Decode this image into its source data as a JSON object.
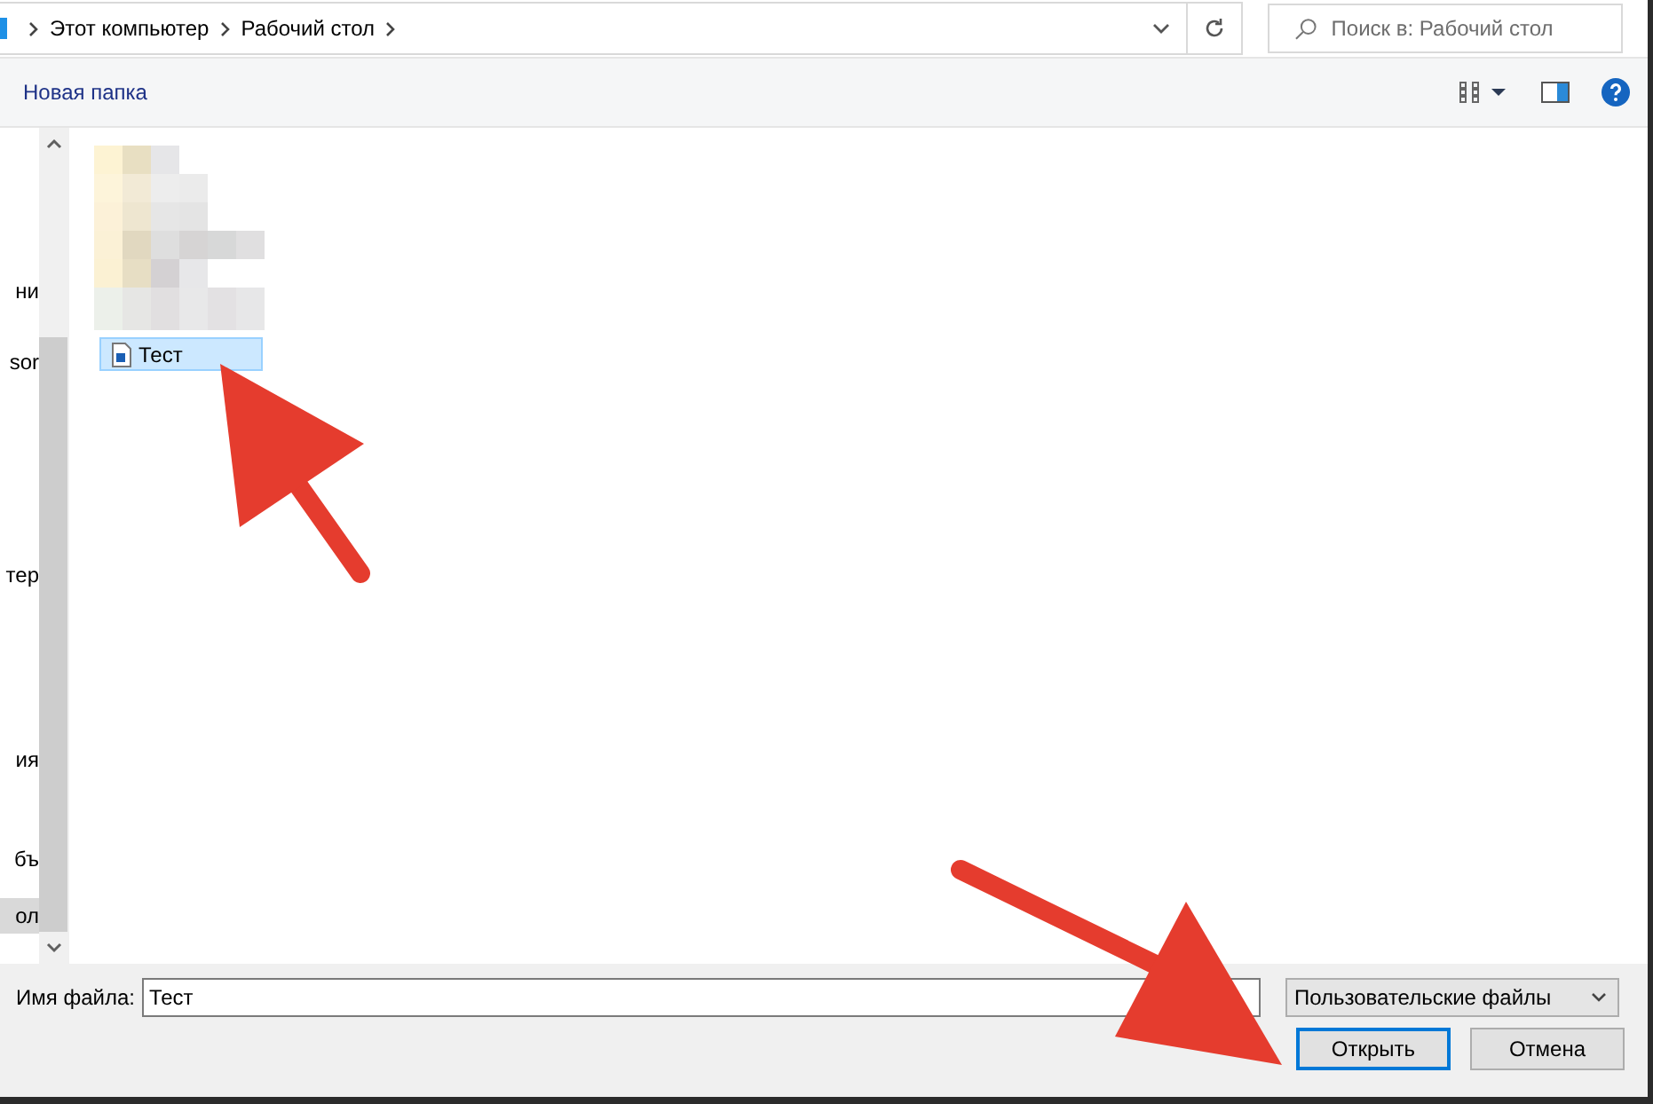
{
  "address_bar": {
    "breadcrumbs": [
      "Этот компьютер",
      "Рабочий стол"
    ]
  },
  "search": {
    "placeholder": "Поиск в: Рабочий стол"
  },
  "toolbar": {
    "new_folder": "Новая папка"
  },
  "sidebar": {
    "items": [
      {
        "label": "ни",
        "selected": false
      },
      {
        "label": "sor",
        "selected": false
      },
      {
        "label": "тер",
        "selected": false
      },
      {
        "label": "ия",
        "selected": false
      },
      {
        "label": "бъ",
        "selected": false
      },
      {
        "label": "ол",
        "selected": true
      }
    ]
  },
  "files": [
    {
      "kind": "picture"
    },
    {
      "kind": "file",
      "name": "Тест",
      "selected": true
    }
  ],
  "footer": {
    "filename_label": "Имя файла:",
    "filename_value": "Тест",
    "filter": "Пользовательские файлы",
    "open_button": "Открыть",
    "cancel_button": "Отмена"
  }
}
